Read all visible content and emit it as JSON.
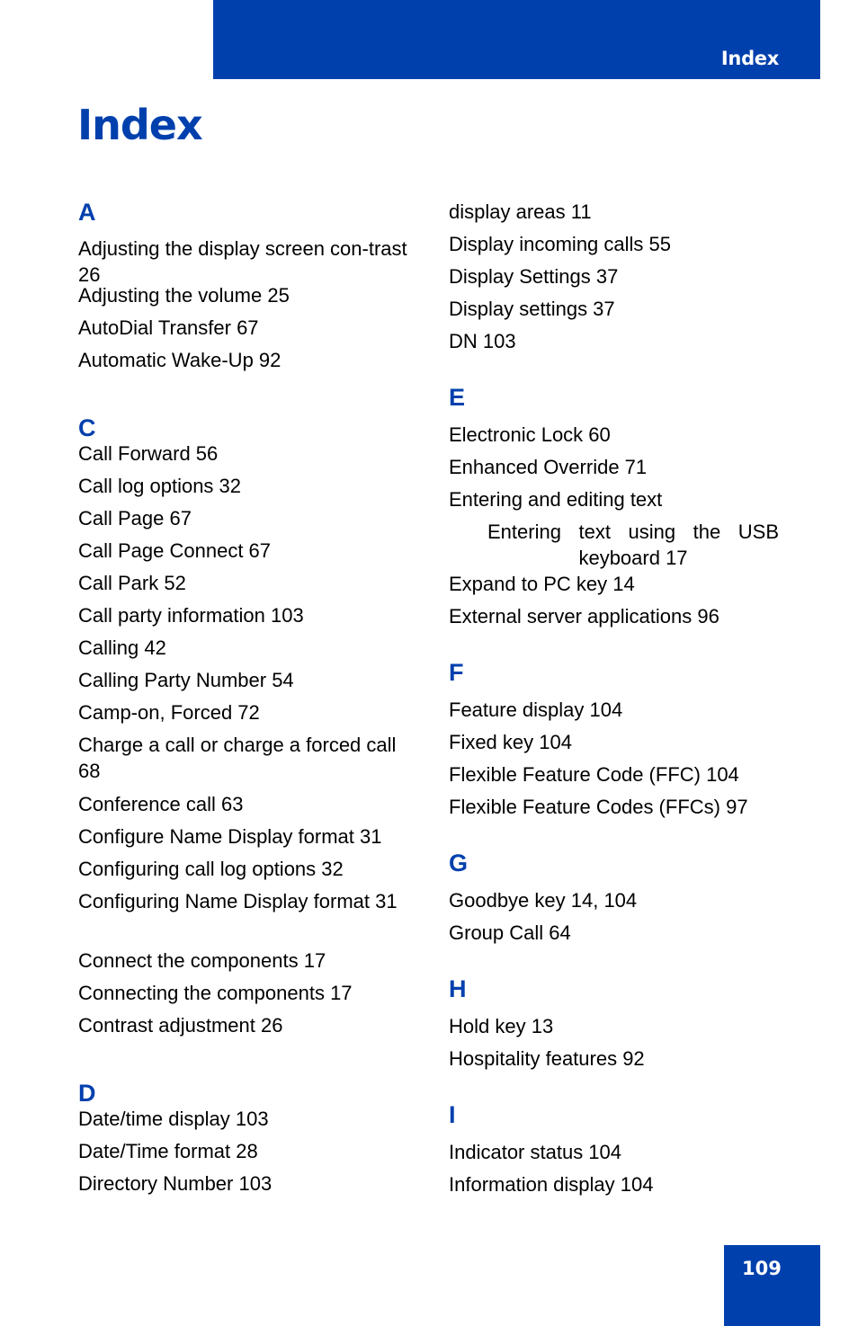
{
  "header": {
    "section_label": "Index"
  },
  "title": "Index",
  "columns": [
    {
      "sections": [
        {
          "letter": "A",
          "entries": [
            {
              "text": "Adjusting the display screen con-trast 26"
            },
            {
              "text": "Adjusting the volume 25"
            },
            {
              "text": "AutoDial Transfer 67"
            },
            {
              "text": "Automatic Wake-Up 92"
            }
          ]
        },
        {
          "letter": "C",
          "entries": [
            {
              "text": "Call Forward 56"
            },
            {
              "text": "Call log options 32"
            },
            {
              "text": "Call Page 67"
            },
            {
              "text": "Call Page Connect 67"
            },
            {
              "text": "Call Park 52"
            },
            {
              "text": "Call party information 103"
            },
            {
              "text": "Calling 42"
            },
            {
              "text": "Calling Party Number 54"
            },
            {
              "text": "Camp-on, Forced 72"
            },
            {
              "text": "Charge a call or charge a forced call 68"
            },
            {
              "text": "Conference call 63"
            },
            {
              "text": "Configure Name Display format 31"
            },
            {
              "text": "Configuring call log options 32"
            },
            {
              "text": "Configuring Name Display format 31"
            },
            {
              "text": "Connect the components 17"
            },
            {
              "text": "Connecting the components 17"
            },
            {
              "text": "Contrast adjustment 26"
            }
          ]
        },
        {
          "letter": "D",
          "entries": [
            {
              "text": "Date/time display 103"
            },
            {
              "text": "Date/Time format 28"
            },
            {
              "text": "Directory Number 103"
            }
          ]
        }
      ]
    },
    {
      "sections": [
        {
          "letter": "",
          "entries": [
            {
              "text": "display areas 11"
            },
            {
              "text": "Display incoming calls 55"
            },
            {
              "text": "Display Settings 37"
            },
            {
              "text": "Display settings 37"
            },
            {
              "text": "DN 103"
            }
          ]
        },
        {
          "letter": "E",
          "entries": [
            {
              "text": "Electronic Lock 60"
            },
            {
              "text": "Enhanced Override 71"
            },
            {
              "text": "Entering and editing text"
            },
            {
              "text": "Entering text using the USB keyboard 17",
              "sub": true
            },
            {
              "text": "Expand to PC key 14"
            },
            {
              "text": "External server applications 96"
            }
          ]
        },
        {
          "letter": "F",
          "entries": [
            {
              "text": "Feature display 104"
            },
            {
              "text": "Fixed key 104"
            },
            {
              "text": "Flexible Feature Code (FFC) 104"
            },
            {
              "text": "Flexible Feature Codes (FFCs) 97"
            }
          ]
        },
        {
          "letter": "G",
          "entries": [
            {
              "text": "Goodbye key 14, 104"
            },
            {
              "text": "Group Call 64"
            }
          ]
        },
        {
          "letter": "H",
          "entries": [
            {
              "text": "Hold key 13"
            },
            {
              "text": "Hospitality features 92"
            }
          ]
        },
        {
          "letter": "I",
          "entries": [
            {
              "text": "Indicator status 104"
            },
            {
              "text": "Information display 104"
            }
          ]
        }
      ]
    }
  ],
  "footer": {
    "page_number": "109"
  },
  "colors": {
    "brand_blue": "#0040ad",
    "text": "#000000",
    "header_text": "#ffffff"
  }
}
